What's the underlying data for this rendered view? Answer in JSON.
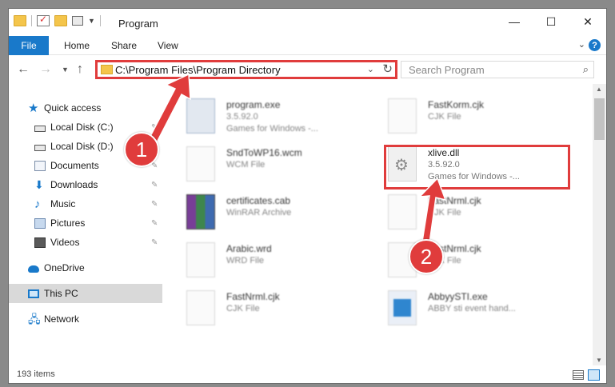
{
  "window": {
    "title": "Program",
    "controls": {
      "minimize": "—",
      "maximize": "☐",
      "close": "✕"
    }
  },
  "ribbon": {
    "file": "File",
    "tabs": [
      "Home",
      "Share",
      "View"
    ],
    "help": "?"
  },
  "address": {
    "path": "C:\\Program Files\\Program Directory",
    "search_placeholder": "Search Program"
  },
  "sidebar": {
    "items": [
      {
        "label": "Quick access",
        "icon": "star-icon",
        "pinned": false
      },
      {
        "label": "Local Disk (C:)",
        "icon": "drive-icon",
        "pinned": true
      },
      {
        "label": "Local Disk (D:)",
        "icon": "drive-icon",
        "pinned": true
      },
      {
        "label": "Documents",
        "icon": "documents-icon",
        "pinned": true
      },
      {
        "label": "Downloads",
        "icon": "download-icon",
        "pinned": true
      },
      {
        "label": "Music",
        "icon": "music-icon",
        "pinned": true
      },
      {
        "label": "Pictures",
        "icon": "pictures-icon",
        "pinned": true
      },
      {
        "label": "Videos",
        "icon": "videos-icon",
        "pinned": true
      },
      {
        "label": "OneDrive",
        "icon": "cloud-icon",
        "pinned": false
      },
      {
        "label": "This PC",
        "icon": "computer-icon",
        "pinned": false,
        "selected": true
      },
      {
        "label": "Network",
        "icon": "network-icon",
        "pinned": false
      }
    ]
  },
  "files": [
    {
      "name": "program.exe",
      "line1": "3.5.92.0",
      "line2": "Games for Windows -...",
      "icon": "exe-icon"
    },
    {
      "name": "FastKorm.cjk",
      "line1": "CJK File",
      "line2": "",
      "icon": "file-icon"
    },
    {
      "name": "SndToWP16.wcm",
      "line1": "WCM File",
      "line2": "",
      "icon": "file-icon"
    },
    {
      "name": "xlive.dll",
      "line1": "3.5.92.0",
      "line2": "Games for Windows -...",
      "icon": "dll-gear-icon",
      "highlighted": true
    },
    {
      "name": "certificates.cab",
      "line1": "WinRAR Archive",
      "line2": "",
      "icon": "winrar-icon"
    },
    {
      "name": "FastNrml.cjk",
      "line1": "CJK File",
      "line2": "",
      "icon": "file-icon"
    },
    {
      "name": "Arabic.wrd",
      "line1": "WRD File",
      "line2": "",
      "icon": "file-icon"
    },
    {
      "name": "FastNrml.cjk",
      "line1": "CJK File",
      "line2": "",
      "icon": "file-icon"
    },
    {
      "name": "FastNrml.cjk",
      "line1": "CJK File",
      "line2": "",
      "icon": "file-icon"
    },
    {
      "name": "AbbyySTI.exe",
      "line1": "ABBY sti event hand...",
      "line2": "",
      "icon": "abbyy-icon"
    }
  ],
  "status": {
    "count": "193 items"
  },
  "annotations": {
    "step1": "1",
    "step2": "2"
  },
  "colors": {
    "accent": "#1979ca",
    "highlight": "#e03c3c"
  }
}
